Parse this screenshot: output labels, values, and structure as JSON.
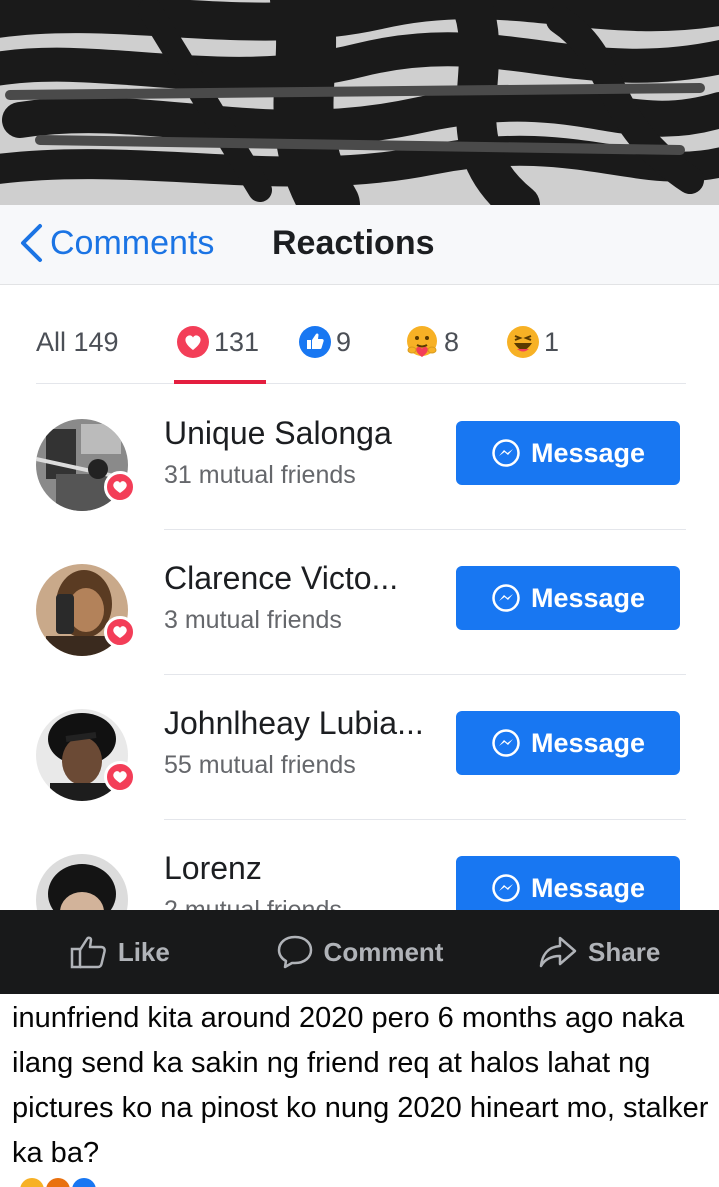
{
  "header": {
    "back_label": "Comments",
    "title": "Reactions"
  },
  "tabs": [
    {
      "label": "All 149",
      "icon": "none"
    },
    {
      "label": "131",
      "icon": "love-reaction-icon"
    },
    {
      "label": "9",
      "icon": "like-reaction-icon"
    },
    {
      "label": "8",
      "icon": "care-reaction-icon"
    },
    {
      "label": "1",
      "icon": "haha-reaction-icon"
    }
  ],
  "people": [
    {
      "name": "Unique Salonga",
      "mutual": "31 mutual friends",
      "button": "Message"
    },
    {
      "name": "Clarence Victo...",
      "mutual": "3 mutual friends",
      "button": "Message"
    },
    {
      "name": "Johnlheay Lubia...",
      "mutual": "55 mutual friends",
      "button": "Message"
    },
    {
      "name": "Lorenz",
      "mutual": "2 mutual friends",
      "button": "Message"
    }
  ],
  "actions": {
    "like": "Like",
    "comment": "Comment",
    "share": "Share"
  },
  "caption": "inunfriend kita around 2020 pero 6 months ago naka ilang send ka sakin ng friend req at halos lahat ng pictures ko na pinost ko nung 2020 hineart mo, stalker ka ba?",
  "colors": {
    "accent": "#1877f2",
    "love": "#f33e58",
    "action_bar": "#18191a"
  }
}
